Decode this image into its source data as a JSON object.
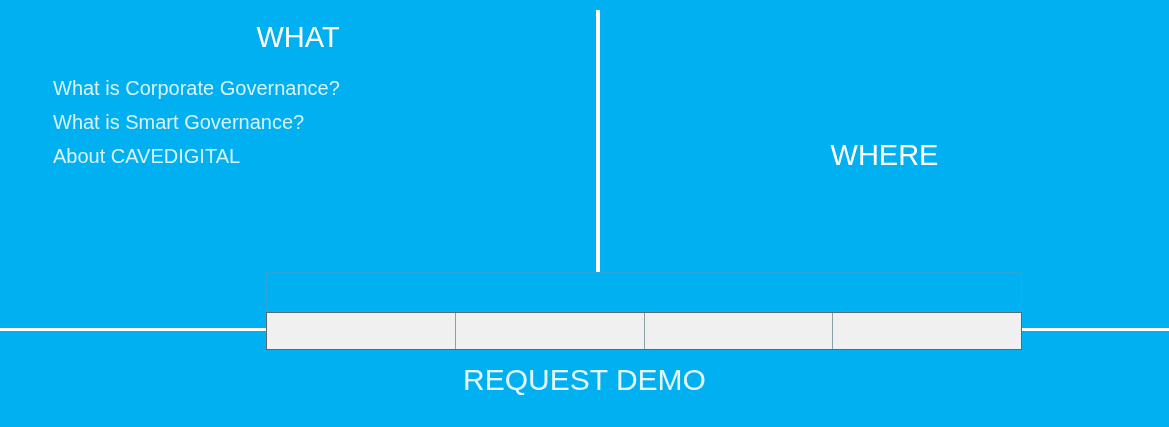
{
  "what": {
    "heading": "WHAT",
    "links": [
      "What is Corporate Governance?",
      "What is Smart Governance?",
      "About CAVEDIGITAL"
    ]
  },
  "where": {
    "heading": "WHERE"
  },
  "tiles": [
    {
      "kind": "blank"
    },
    {
      "kind": "blank"
    },
    {
      "kind": "blank"
    },
    {
      "kind": "blank"
    }
  ],
  "request_demo": "REQUEST DEMO"
}
